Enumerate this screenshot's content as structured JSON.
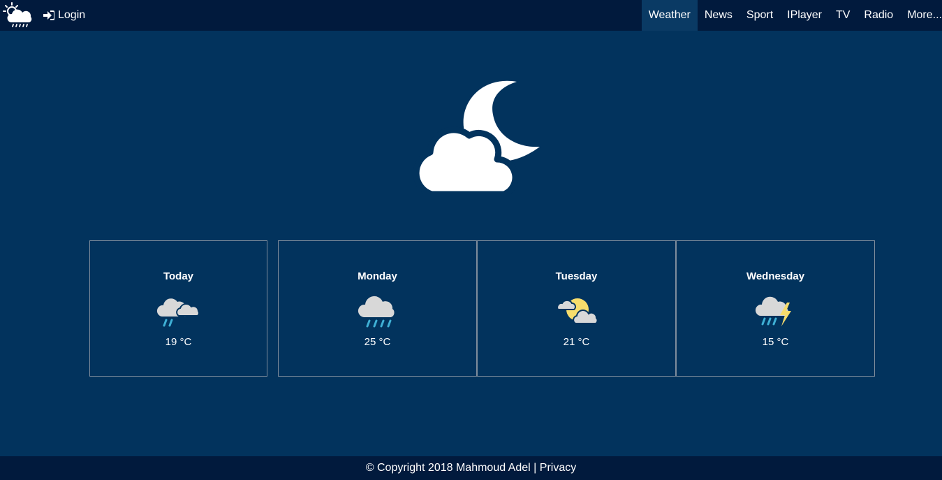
{
  "header": {
    "logo_icon": "cloud-sun-rain-icon",
    "login_icon": "sign-in-icon",
    "login_label": "Login",
    "nav": [
      {
        "label": "Weather",
        "active": true
      },
      {
        "label": "News"
      },
      {
        "label": "Sport"
      },
      {
        "label": "IPlayer"
      },
      {
        "label": "TV"
      },
      {
        "label": "Radio"
      },
      {
        "label": "More..."
      }
    ]
  },
  "hero": {
    "icon": "cloud-moon-icon"
  },
  "forecast": [
    {
      "day": "Today",
      "icon": "partly-cloudy-rain-icon",
      "temp": "19 °C"
    },
    {
      "day": "Monday",
      "icon": "rain-cloud-icon",
      "temp": "25 °C"
    },
    {
      "day": "Tuesday",
      "icon": "sun-behind-clouds-icon",
      "temp": "21 °C"
    },
    {
      "day": "Wednesday",
      "icon": "thunderstorm-rain-icon",
      "temp": "15 °C"
    }
  ],
  "footer": {
    "copyright": "© Copyright 2018 Mahmoud Adel",
    "separator": "|",
    "privacy_label": "Privacy"
  },
  "colors": {
    "header_bg": "#011a3d",
    "page_bg": "#02335d",
    "active_tab_bg": "#0a3a64",
    "card_border": "#7f8d9c",
    "sun": "#f7dd6c",
    "rain": "#3fb0d5",
    "cloud": "#d8d8d8",
    "lightning": "#f7dd6c"
  }
}
